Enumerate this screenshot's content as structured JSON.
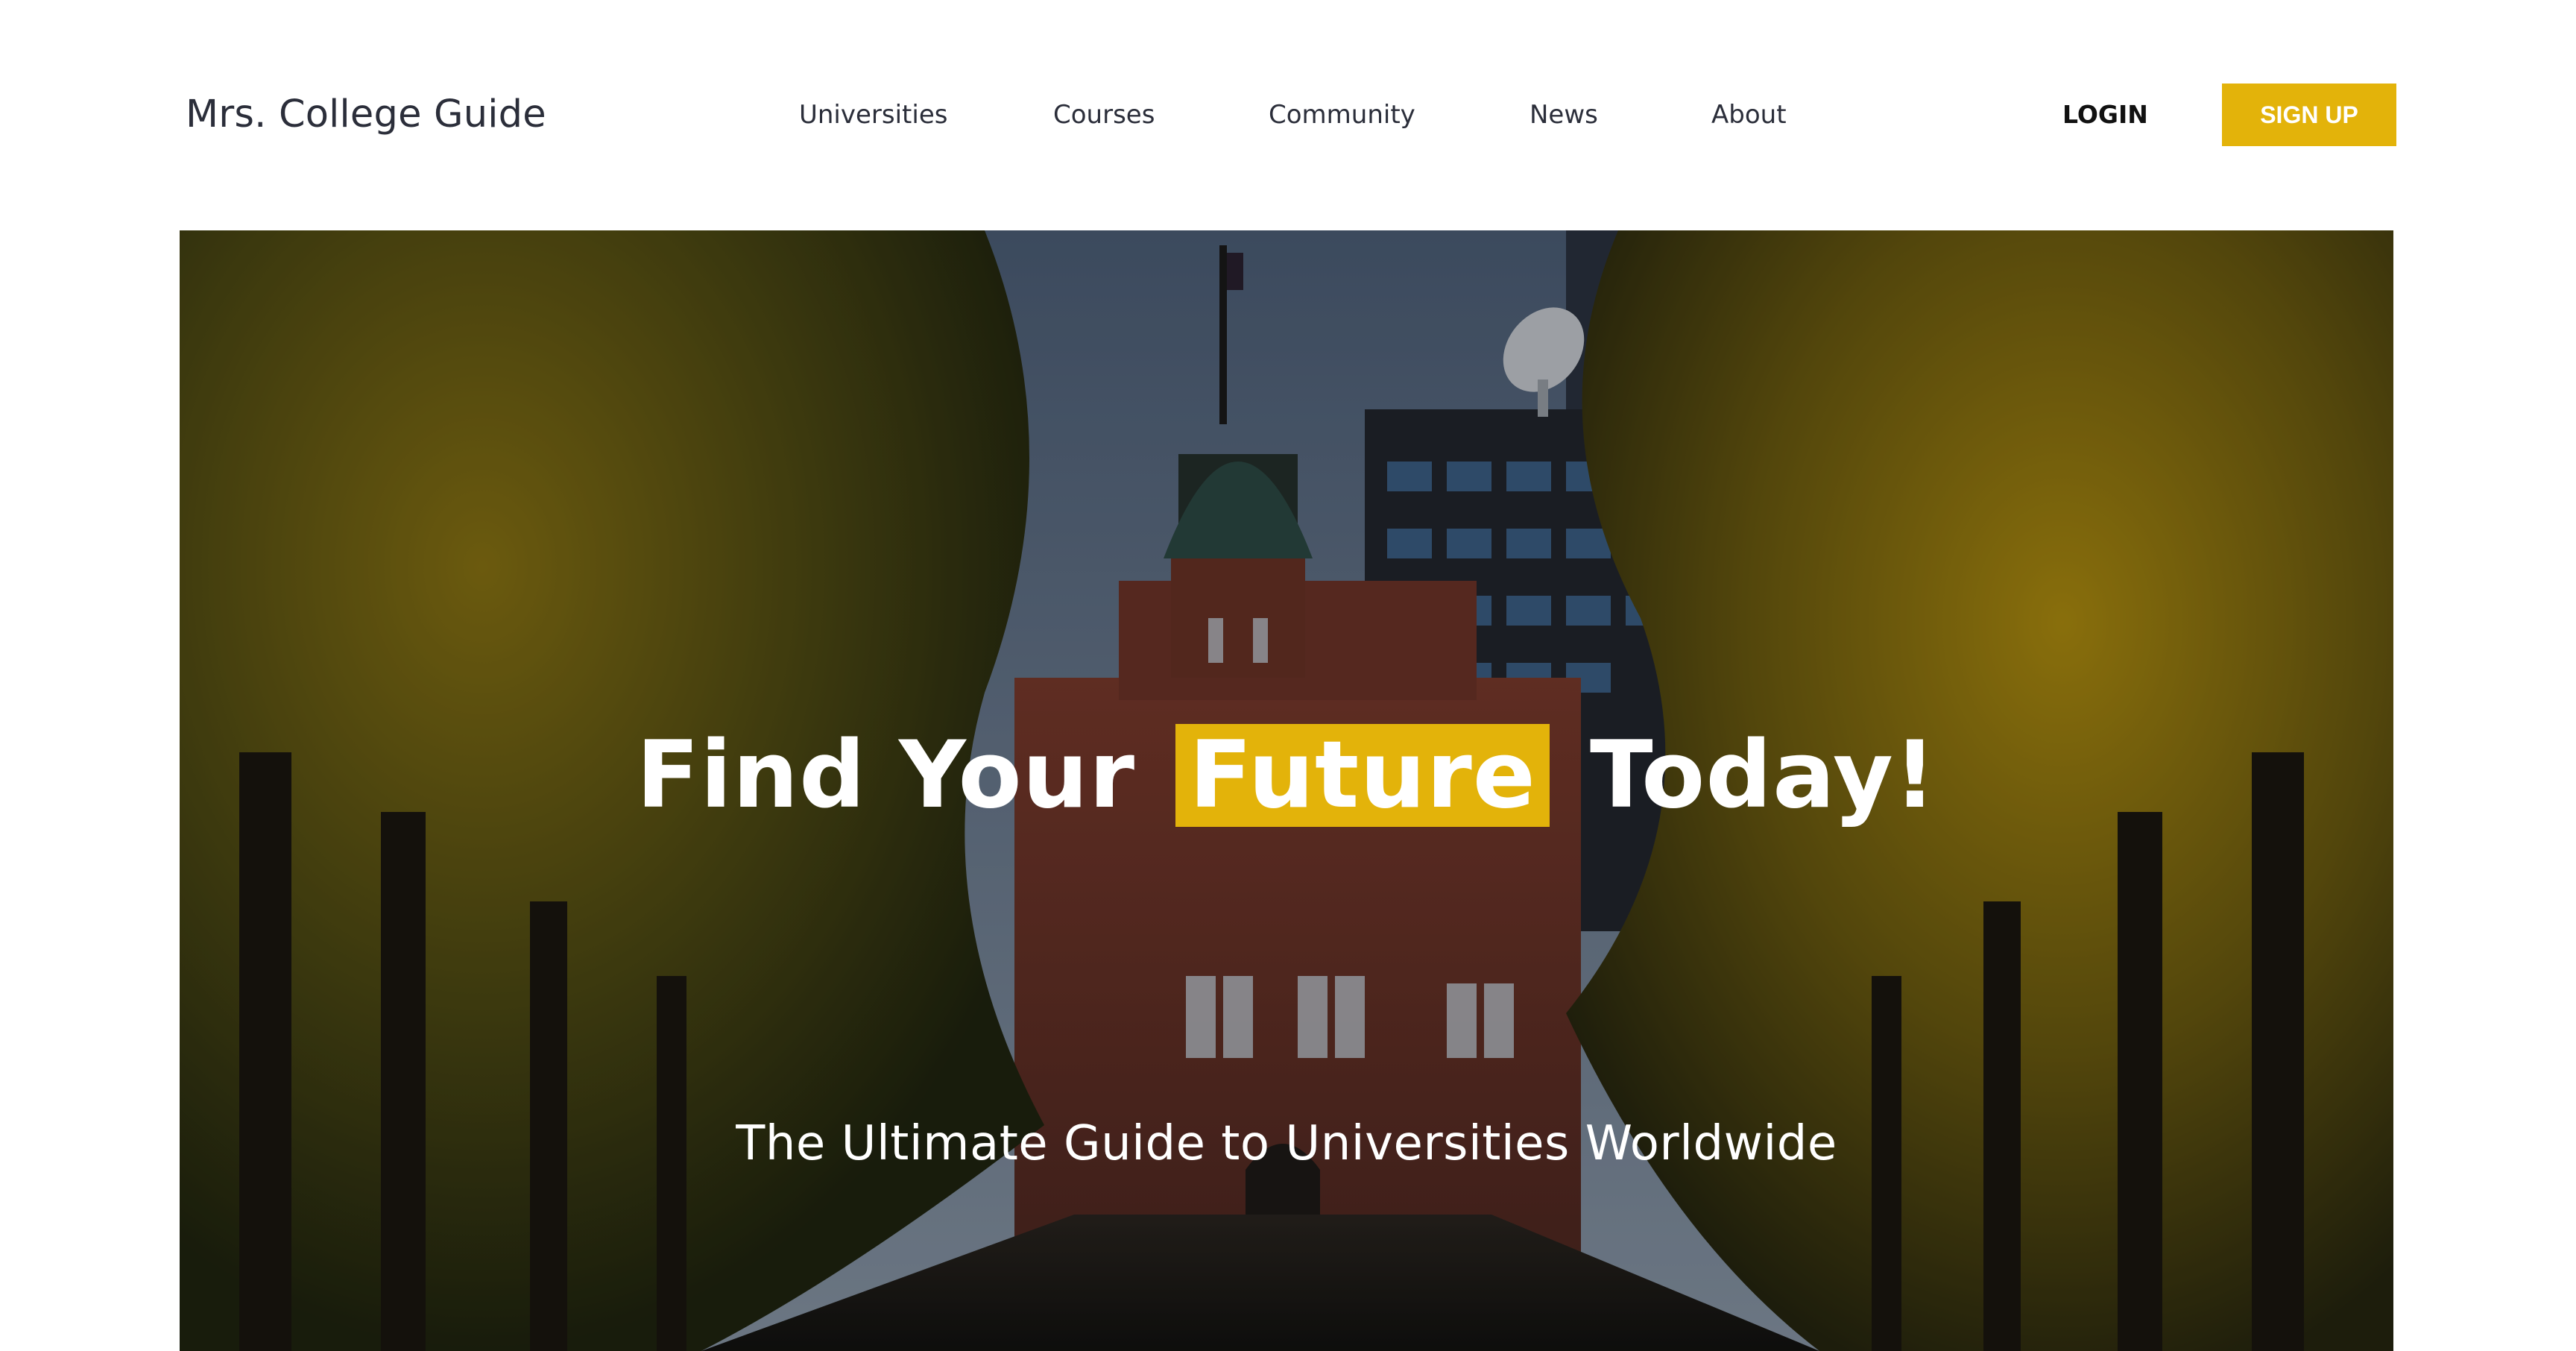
{
  "header": {
    "brand": "Mrs. College Guide",
    "nav": {
      "universities": "Universities",
      "courses": "Courses",
      "community": "Community",
      "news": "News",
      "about": "About"
    },
    "login_label": "LOGIN",
    "signup_label": "SIGN UP"
  },
  "hero": {
    "heading_before": "Find Your",
    "heading_highlight": "Future",
    "heading_after": "Today!",
    "subtitle": "The Ultimate Guide to Universities Worldwide"
  },
  "colors": {
    "accent": "#e3b30a",
    "text_dark": "#2b2e3a",
    "hero_text": "#ffffff"
  }
}
